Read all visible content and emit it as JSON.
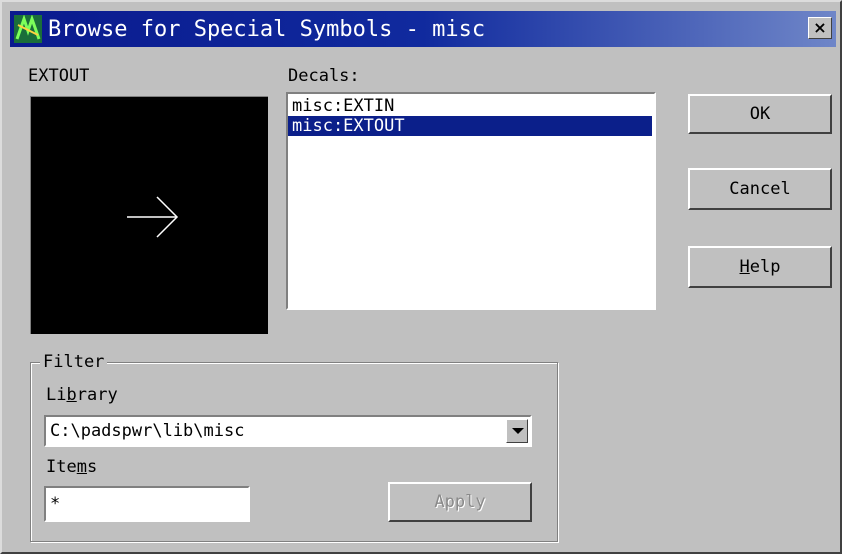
{
  "window": {
    "title": "Browse for Special Symbols - misc",
    "close_label": "×"
  },
  "preview": {
    "label": "EXTOUT",
    "symbol": "→"
  },
  "decals": {
    "label": "Decals:",
    "items": [
      "misc:EXTIN",
      "misc:EXTOUT"
    ],
    "selected": "misc:EXTOUT"
  },
  "buttons": {
    "ok": "OK",
    "cancel": "Cancel",
    "help_mnemonic": "H",
    "help_rest": "elp",
    "apply": "Apply"
  },
  "filter": {
    "title": "Filter",
    "library_label_pre": "Li",
    "library_label_mnemonic": "b",
    "library_label_post": "rary",
    "library_value": "C:\\padspwr\\lib\\misc",
    "items_label_pre": "Ite",
    "items_label_mnemonic": "m",
    "items_label_post": "s",
    "items_value": "*"
  },
  "colors": {
    "selection": "#0b1f8a",
    "dialog_face": "#c0c0c0"
  }
}
